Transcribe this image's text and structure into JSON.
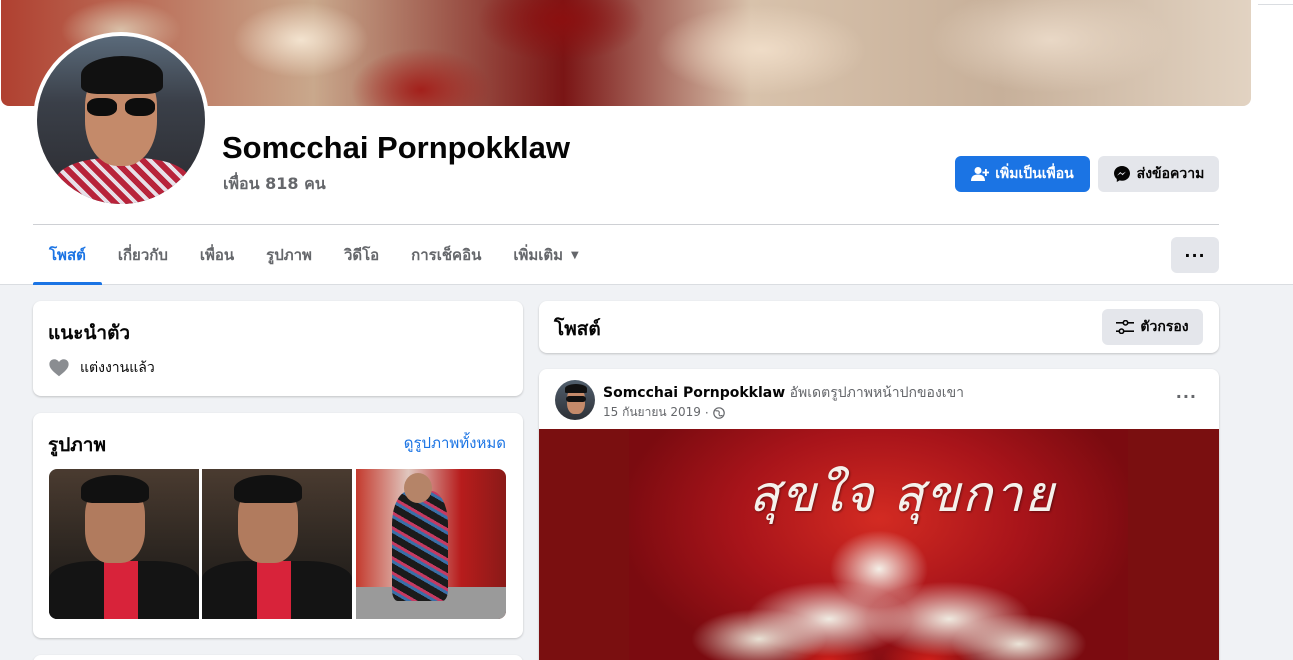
{
  "profile": {
    "name": "Somcchai Pornpokklaw",
    "friends": "เพื่อน 818 คน"
  },
  "actions": {
    "add_friend": "เพิ่มเป็นเพื่อน",
    "message": "ส่งข้อความ",
    "more": "···"
  },
  "tabs": [
    {
      "label": "โพสต์",
      "active": true
    },
    {
      "label": "เกี่ยวกับ"
    },
    {
      "label": "เพื่อน"
    },
    {
      "label": "รูปภาพ"
    },
    {
      "label": "วิดีโอ"
    },
    {
      "label": "การเช็คอิน"
    },
    {
      "label": "เพิ่มเติม"
    }
  ],
  "intro": {
    "title": "แนะนำตัว",
    "relationship": "แต่งงานแล้ว"
  },
  "photos": {
    "title": "รูปภาพ",
    "see_all": "ดูรูปภาพทั้งหมด"
  },
  "posts": {
    "title": "โพสต์",
    "filter": "ตัวกรอง"
  },
  "post": {
    "author": "Somcchai Pornpokklaw",
    "action": "อัพเดตรูปภาพหน้าปกของเขา",
    "date": "15 กันยายน 2019",
    "separator": "·",
    "more": "···",
    "image_text": "สุขใจ สุขกาย"
  },
  "colors": {
    "accent": "#1b74e4",
    "page_bg": "#f0f2f5",
    "secondary_text": "#65676b",
    "button_gray": "#e4e6eb"
  }
}
